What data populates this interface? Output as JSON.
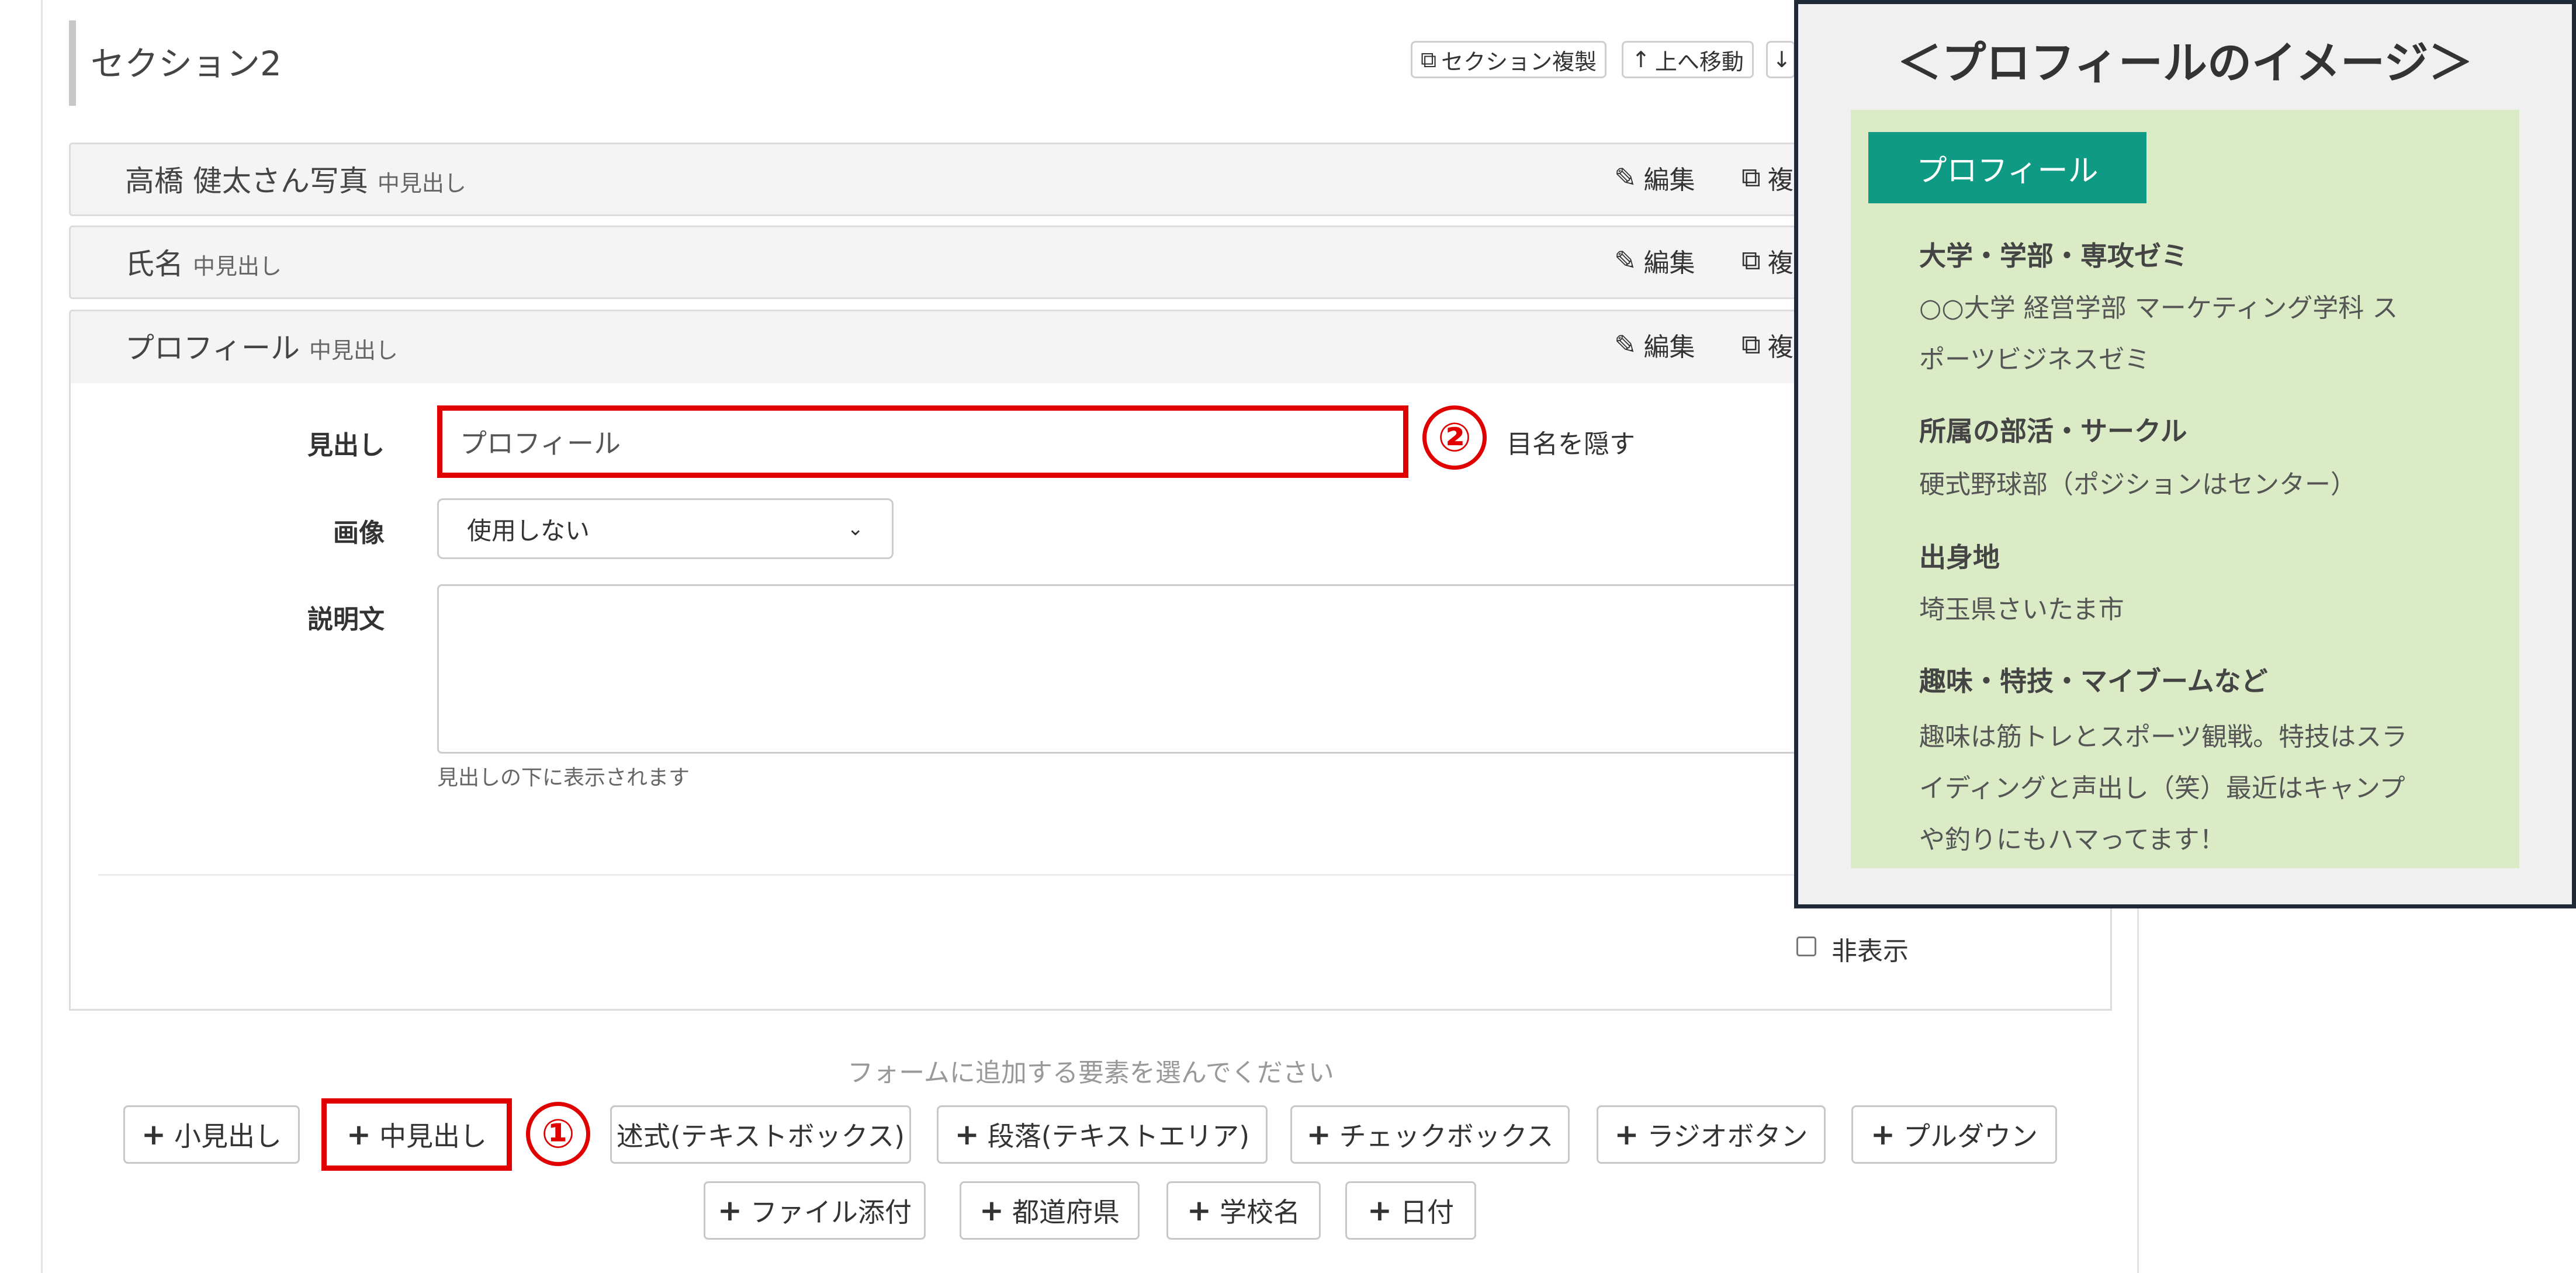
{
  "section": {
    "title": "セクション2",
    "toolbar": {
      "duplicate_label": "セクション複製",
      "move_up_label": "上へ移動",
      "move_down_icon": "↓"
    }
  },
  "rows": [
    {
      "title": "高橋 健太さん写真",
      "subtitle": "中見出し",
      "edit_label": "編集",
      "copy_label": "複"
    },
    {
      "title": "氏名",
      "subtitle": "中見出し",
      "edit_label": "編集",
      "copy_label": "複"
    },
    {
      "title": "プロフィール",
      "subtitle": "中見出し",
      "edit_label": "編集",
      "copy_label": "複"
    }
  ],
  "form": {
    "heading_label": "見出し",
    "heading_value": "プロフィール",
    "hide_item_label": "目名を隠す",
    "image_label": "画像",
    "image_selected": "使用しない",
    "description_label": "説明文",
    "description_help": "見出しの下に表示されます",
    "hidden_label": "非表示"
  },
  "add_prompt": "フォームに追加する要素を選んでください",
  "add_buttons_row1": [
    {
      "label": "小見出し"
    },
    {
      "label": "中見出し"
    },
    {
      "label": "述式(テキストボックス)"
    },
    {
      "label": "段落(テキストエリア)"
    },
    {
      "label": "チェックボックス"
    },
    {
      "label": "ラジオボタン"
    },
    {
      "label": "プルダウン"
    }
  ],
  "add_buttons_row2": [
    {
      "label": "ファイル添付"
    },
    {
      "label": "都道府県"
    },
    {
      "label": "学校名"
    },
    {
      "label": "日付"
    }
  ],
  "annotations": {
    "step1": "①",
    "step2": "②"
  },
  "profile_preview": {
    "title": "＜プロフィールのイメージ＞",
    "badge": "プロフィール",
    "items": [
      {
        "label": "大学・学部・専攻ゼミ",
        "lines": [
          "○○大学 経営学部 マーケティング学科 ス",
          "ポーツビジネスゼミ"
        ]
      },
      {
        "label": "所属の部活・サークル",
        "lines": [
          "硬式野球部（ポジションはセンター）"
        ]
      },
      {
        "label": "出身地",
        "lines": [
          "埼玉県さいたま市"
        ]
      },
      {
        "label": "趣味・特技・マイブームなど",
        "lines": [
          "趣味は筋トレとスポーツ観戦。特技はスラ",
          "イディングと声出し（笑）最近はキャンプ",
          "や釣りにもハマってます！"
        ]
      }
    ]
  },
  "colors": {
    "accent_red": "#e00000",
    "badge_teal": "#0f9a83",
    "card_green": "#dbebc6"
  }
}
